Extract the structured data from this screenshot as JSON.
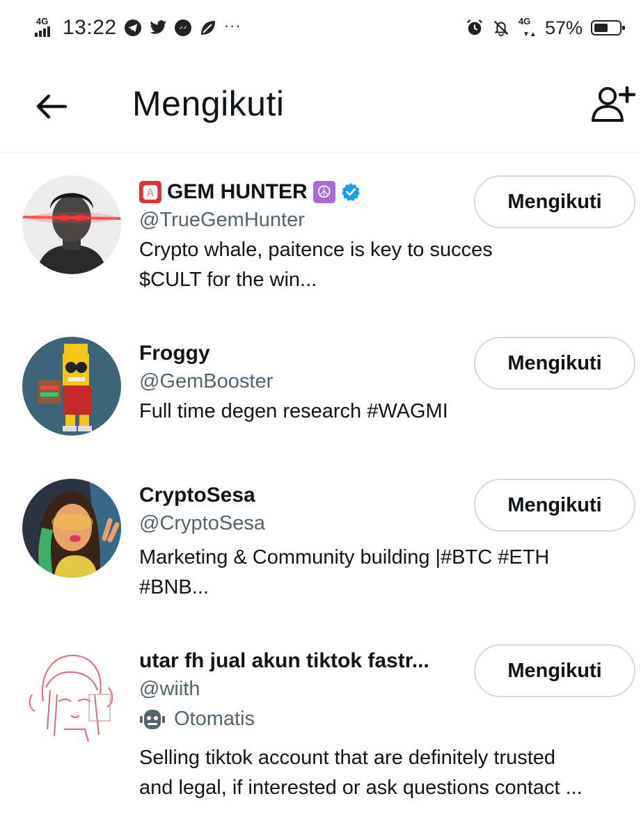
{
  "status_bar": {
    "network_left": "4G",
    "time": "13:22",
    "app_icons": [
      "telegram-icon",
      "twitter-icon",
      "messenger-icon",
      "leaf-app-icon"
    ],
    "more": "···",
    "right_icons": [
      "alarm-icon",
      "notifications-off-icon"
    ],
    "network_right": "4G",
    "battery_percent": "57%",
    "battery_level": 0.57
  },
  "header": {
    "title": "Mengikuti",
    "back_icon": "arrow-left-icon",
    "add_icon": "add-user-icon"
  },
  "users": [
    {
      "name": "GEM HUNTER",
      "name_prefix_emoji": "🅰",
      "name_suffix_emoji": "☮",
      "verified": true,
      "handle": "@TrueGemHunter",
      "bio_lines": [
        "Crypto whale, paitence is key to succes",
        "$CULT for the win..."
      ],
      "button": "Mengikuti"
    },
    {
      "name": "Froggy",
      "handle": "@GemBooster",
      "bio_lines": [
        "Full time degen research #WAGMI"
      ],
      "button": "Mengikuti"
    },
    {
      "name": "CryptoSesa",
      "handle": "@CryptoSesa",
      "bio_lines": [
        "Marketing & Community building |#BTC #ETH",
        "#BNB..."
      ],
      "button": "Mengikuti"
    },
    {
      "name": "utar fh jual akun tiktok fastr...",
      "handle": "@wiith",
      "automated_label": "Otomatis",
      "bio_lines": [
        "Selling tiktok account that are definitely trusted",
        "and legal, if interested or ask questions contact ..."
      ],
      "button": "Mengikuti"
    }
  ],
  "colors": {
    "text_primary": "#0f1419",
    "text_secondary": "#536471",
    "verified_blue": "#1d9bf0",
    "button_border": "#cfd9de"
  }
}
